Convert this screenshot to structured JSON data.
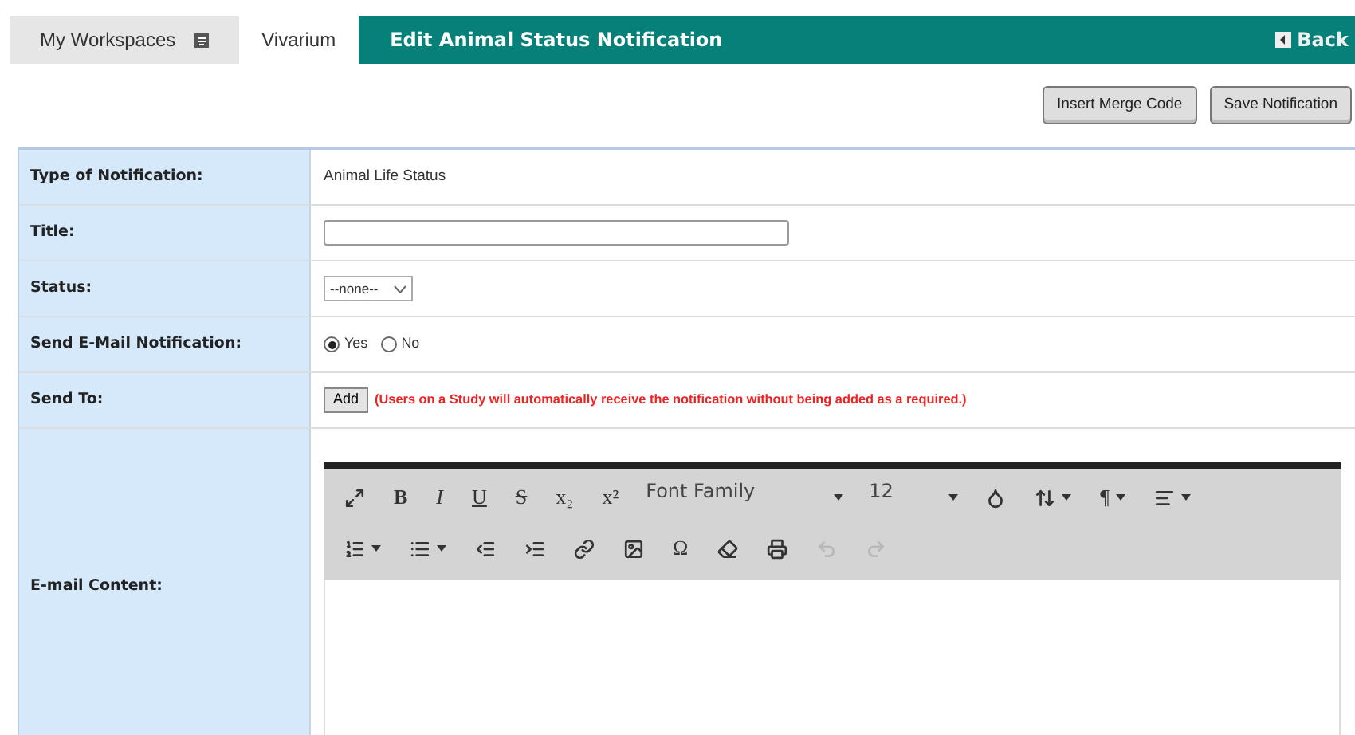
{
  "tabs": [
    {
      "label": "My Workspaces",
      "selected": false,
      "menu": true
    },
    {
      "label": "Vivarium",
      "selected": true,
      "menu": false
    }
  ],
  "header": {
    "title": "Edit Animal Status Notification",
    "back": "Back"
  },
  "actions": [
    "Insert Merge Code",
    "Save Notification"
  ],
  "form": {
    "type": {
      "label": "Type of Notification:",
      "value": "Animal Life Status"
    },
    "title": {
      "label": "Title:"
    },
    "status": {
      "label": "Status:",
      "value": "--none--"
    },
    "send_email": {
      "label": "Send E-Mail Notification:",
      "options": [
        {
          "label": "Yes",
          "selected": true
        },
        {
          "label": "No",
          "selected": false
        }
      ]
    },
    "send_to": {
      "label": "Send To:",
      "button": "Add",
      "note": "(Users on a Study will automatically receive the notification without being added as a required.)"
    },
    "content": {
      "label": "E-mail Content:"
    }
  },
  "toolbar": [
    [
      {
        "kind": "icon"
      },
      {
        "kind": "text",
        "label": "B"
      },
      {
        "kind": "text",
        "label": "I"
      },
      {
        "kind": "text",
        "label": "U"
      },
      {
        "kind": "text",
        "label": "S"
      },
      {
        "kind": "text",
        "label": "x₂"
      },
      {
        "kind": "text",
        "label": "x²"
      },
      {
        "kind": "select",
        "label": "Font Family"
      },
      {
        "kind": "select",
        "label": "12"
      },
      {
        "kind": "icon"
      },
      {
        "kind": "icon",
        "caret": true
      },
      {
        "kind": "text",
        "label": "¶",
        "caret": true
      },
      {
        "kind": "icon",
        "caret": true
      }
    ],
    [
      {
        "kind": "icon",
        "caret": true
      },
      {
        "kind": "icon",
        "caret": true
      },
      {
        "kind": "icon"
      },
      {
        "kind": "icon"
      },
      {
        "kind": "icon"
      },
      {
        "kind": "icon"
      },
      {
        "kind": "text",
        "label": "Ω"
      },
      {
        "kind": "icon"
      },
      {
        "kind": "icon"
      },
      {
        "kind": "icon",
        "disabled": true
      },
      {
        "kind": "icon",
        "disabled": true
      }
    ]
  ]
}
